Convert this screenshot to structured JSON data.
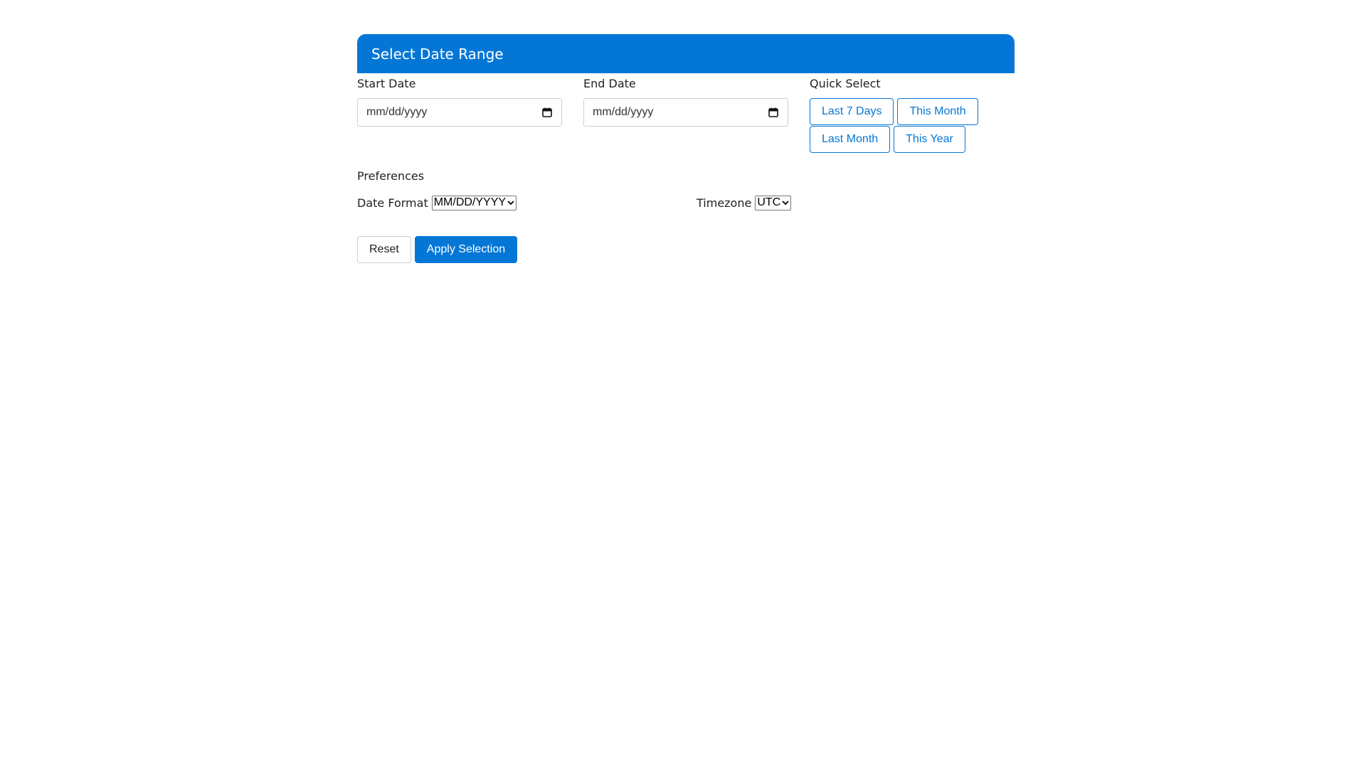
{
  "header": {
    "title": "Select Date Range"
  },
  "start_date": {
    "label": "Start Date",
    "placeholder": "mm/dd/yyyy"
  },
  "end_date": {
    "label": "End Date",
    "placeholder": "mm/dd/yyyy"
  },
  "quick_select": {
    "label": "Quick Select",
    "buttons": [
      "Last 7 Days",
      "This Month",
      "Last Month",
      "This Year"
    ]
  },
  "preferences": {
    "label": "Preferences",
    "date_format": {
      "label": "Date Format",
      "selected": "MM/DD/YYYY"
    },
    "timezone": {
      "label": "Timezone",
      "selected": "UTC"
    }
  },
  "actions": {
    "reset_label": "Reset",
    "apply_label": "Apply Selection"
  },
  "colors": {
    "accent": "#0477d6",
    "border": "#cfcfcf"
  },
  "icons": {
    "date_picker": "calendar-icon",
    "select": "chevron-down-icon"
  }
}
